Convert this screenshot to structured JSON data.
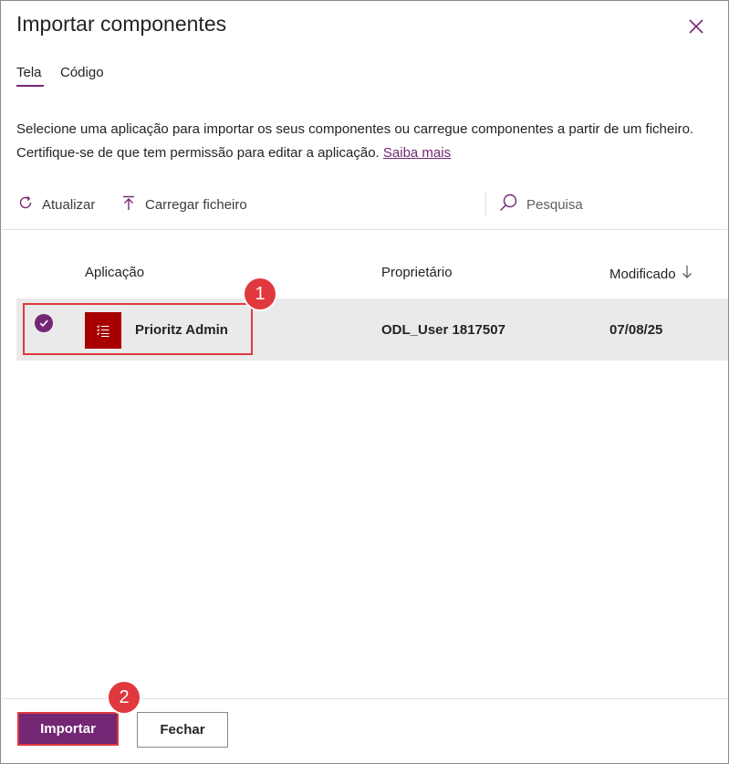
{
  "dialog": {
    "title": "Importar componentes",
    "close_icon": "close-icon"
  },
  "tabs": [
    {
      "label": "Tela",
      "active": true
    },
    {
      "label": "Código",
      "active": false
    }
  ],
  "description": {
    "line1": "Selecione uma aplicação para importar os seus componentes ou carregue componentes a partir de um ficheiro.",
    "line2": "Certifique-se de que tem permissão para editar a aplicação.",
    "link": "Saiba mais"
  },
  "toolbar": {
    "refresh_label": "Atualizar",
    "refresh_icon": "refresh-icon",
    "upload_label": "Carregar ficheiro",
    "upload_icon": "upload-icon",
    "search_placeholder": "Pesquisa",
    "search_icon": "search-icon"
  },
  "table": {
    "columns": [
      "Aplicação",
      "Proprietário",
      "Modificado"
    ],
    "sort_icon": "arrow-down-icon",
    "rows": [
      {
        "selected": true,
        "app": "Prioritz Admin",
        "icon": "list-icon",
        "owner": "ODL_User 1817507",
        "modified": "07/08/25"
      }
    ]
  },
  "annotations": {
    "badge1": "1",
    "badge2": "2"
  },
  "footer": {
    "import_label": "Importar",
    "close_label": "Fechar"
  },
  "colors": {
    "accent": "#742774",
    "app_icon_bg": "#a80000",
    "callout": "#e0383e",
    "selected_row_bg": "#eaeaea"
  }
}
